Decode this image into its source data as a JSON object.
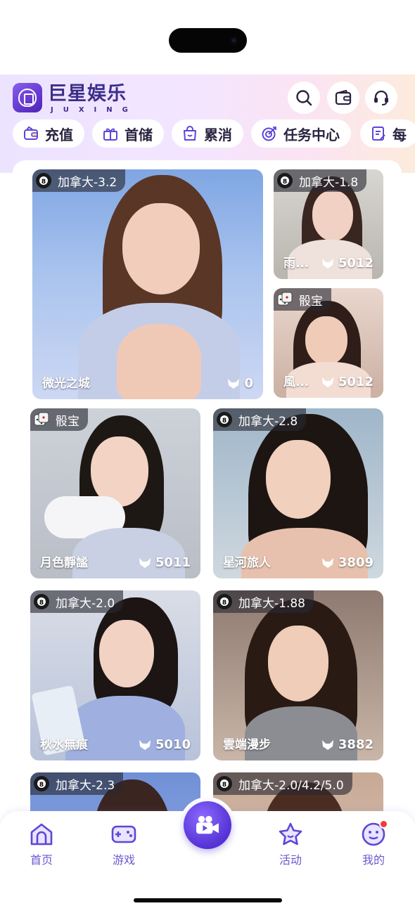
{
  "brand": {
    "title": "巨星娱乐",
    "subtitle": "JUXING"
  },
  "header_icons": [
    "search-icon",
    "wallet-icon",
    "headset-icon"
  ],
  "chips": [
    {
      "label": "充值",
      "icon": "recharge-icon"
    },
    {
      "label": "首储",
      "icon": "gift-icon"
    },
    {
      "label": "累消",
      "icon": "bag-icon"
    },
    {
      "label": "任务中心",
      "icon": "target-icon"
    },
    {
      "label": "每",
      "icon": "checklist-icon"
    }
  ],
  "cards": [
    {
      "tag": "加拿大-3.2",
      "tag_icon": "billiard-8-ball-icon",
      "name": "微光之城",
      "count": "0"
    },
    {
      "tag": "加拿大-1.8",
      "tag_icon": "billiard-8-ball-icon",
      "name": "雨...",
      "count": "5012"
    },
    {
      "tag": "骰宝",
      "tag_icon": "dice-icon",
      "name": "風...",
      "count": "5012"
    },
    {
      "tag": "骰宝",
      "tag_icon": "dice-icon",
      "name": "月色靜謐",
      "count": "5011"
    },
    {
      "tag": "加拿大-2.8",
      "tag_icon": "billiard-8-ball-icon",
      "name": "星河旅人",
      "count": "3809"
    },
    {
      "tag": "加拿大-2.0",
      "tag_icon": "billiard-8-ball-icon",
      "name": "秋水無痕",
      "count": "5010"
    },
    {
      "tag": "加拿大-1.88",
      "tag_icon": "billiard-8-ball-icon",
      "name": "雲端漫步",
      "count": "3882"
    },
    {
      "tag": "加拿大-2.3",
      "tag_icon": "billiard-8-ball-icon",
      "name": "",
      "count": ""
    },
    {
      "tag": "加拿大-2.0/4.2/5.0",
      "tag_icon": "billiard-8-ball-icon",
      "name": "",
      "count": ""
    }
  ],
  "tabs": [
    {
      "label": "首页",
      "icon": "home-icon"
    },
    {
      "label": "游戏",
      "icon": "gamepad-icon"
    },
    {
      "label": "",
      "icon": "video-camera-icon"
    },
    {
      "label": "活动",
      "icon": "star-icon"
    },
    {
      "label": "我的",
      "icon": "smiley-icon"
    }
  ],
  "colors": {
    "accent": "#5f45d6",
    "brand_text": "#3c2e8a",
    "notification": "#f23a3a"
  }
}
